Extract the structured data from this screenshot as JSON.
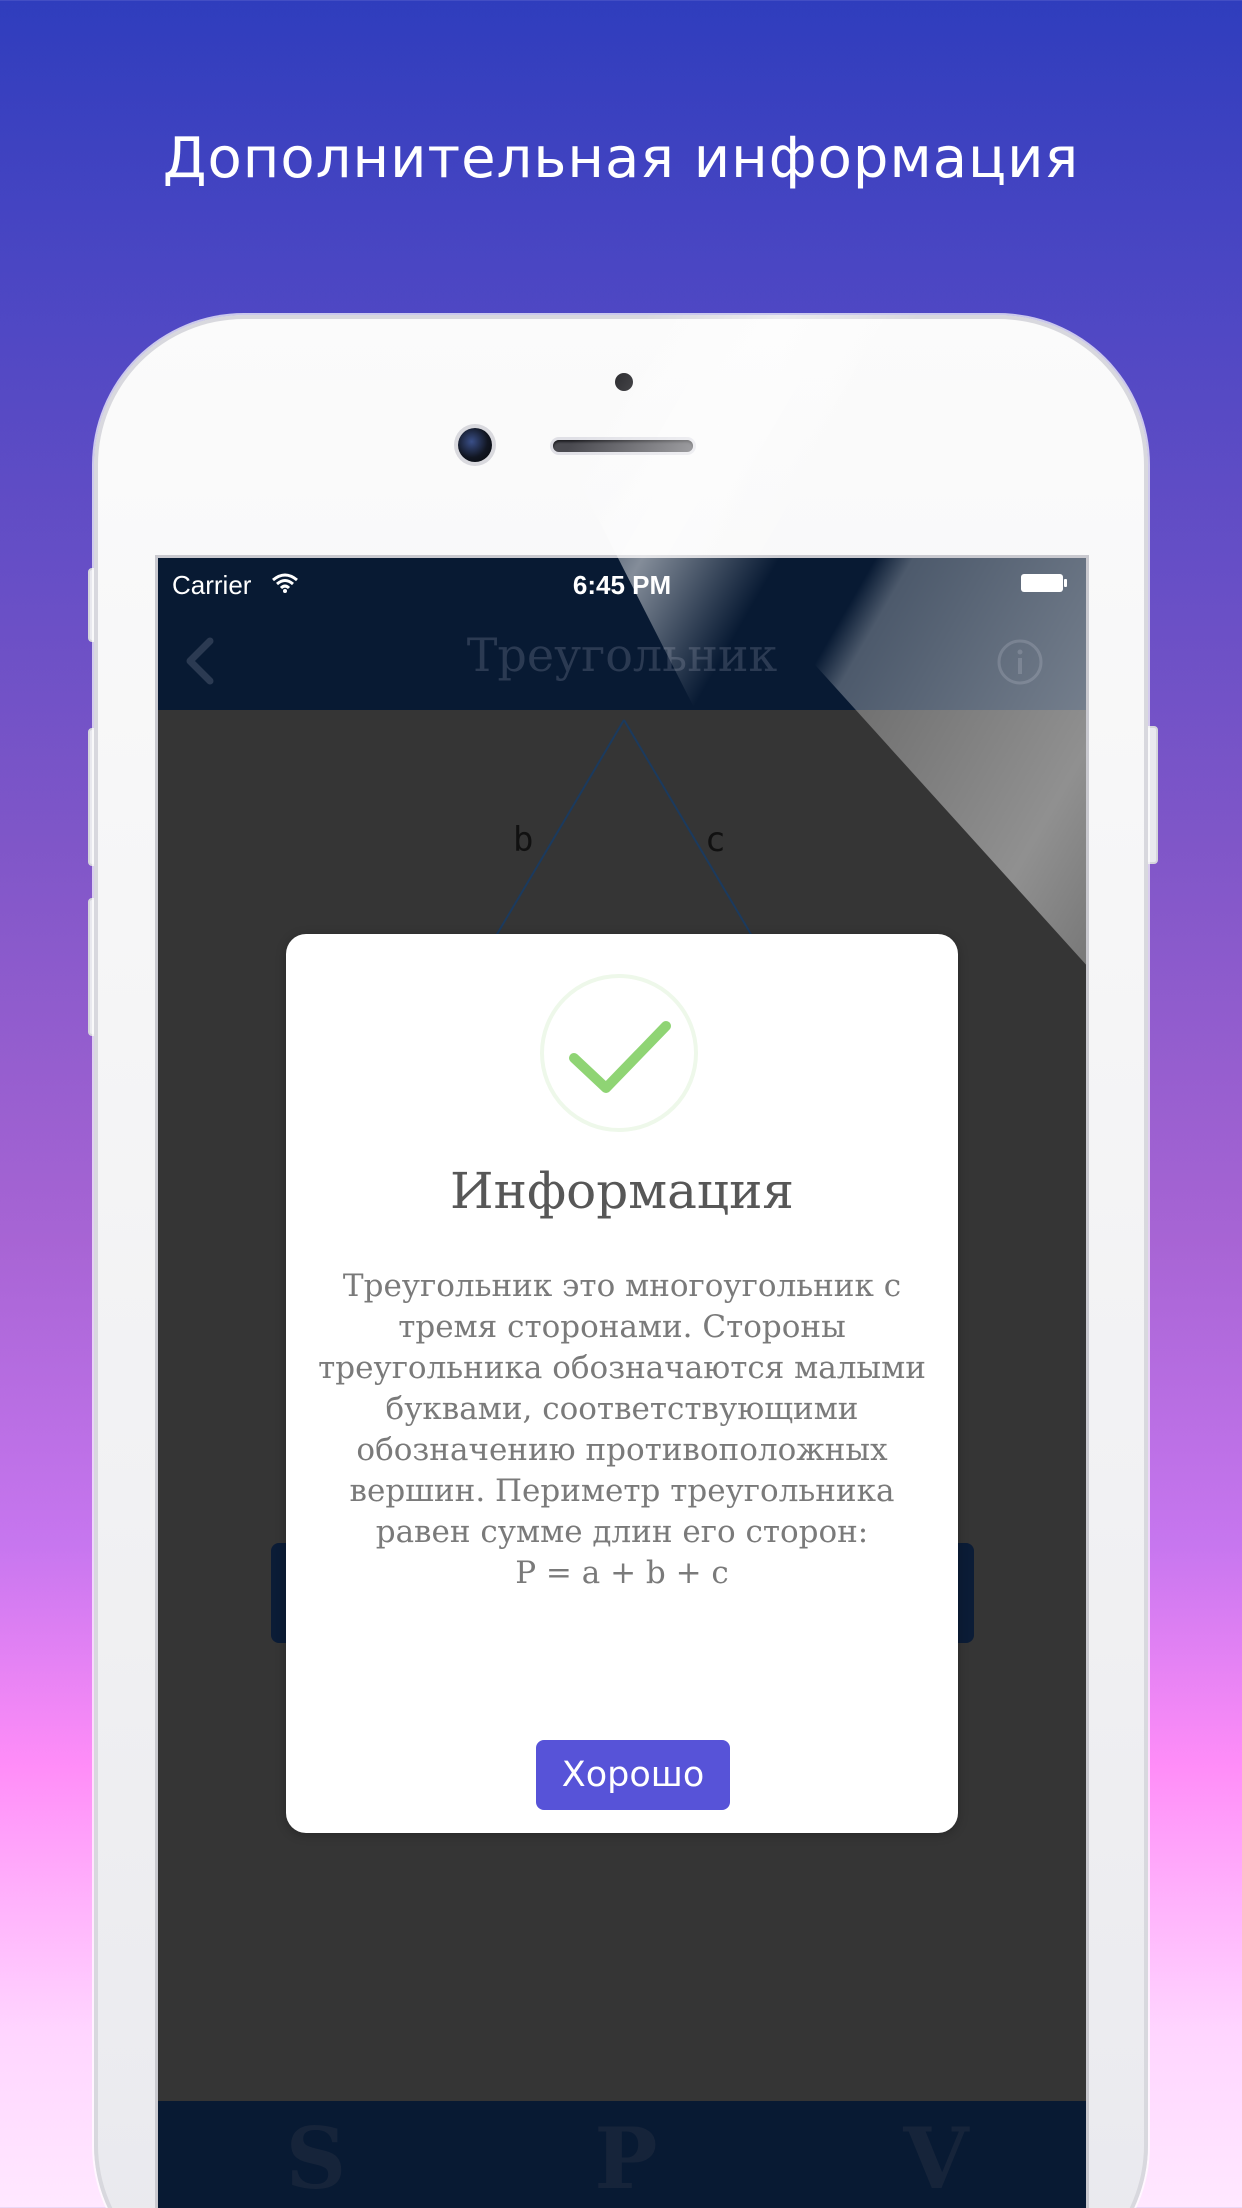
{
  "headline": "Дополнительная информация",
  "status_bar": {
    "carrier": "Carrier",
    "time": "6:45 PM"
  },
  "nav": {
    "title": "Треугольник",
    "back_icon": "chevron-left-icon",
    "info_icon": "info-icon"
  },
  "triangle": {
    "labels": [
      "b",
      "c"
    ]
  },
  "tabs": [
    "S",
    "P",
    "V"
  ],
  "dialog": {
    "icon": "checkmark-icon",
    "title": "Информация",
    "text": "Треугольник это многоугольник с тремя сторонами. Стороны треугольника обозначаются малыми буквами, соответствующими обозначению противоположных вершин. Периметр треугольника равен сумме длин его сторон:",
    "formula": "P = a + b + c",
    "ok_label": "Хорошо"
  },
  "colors": {
    "accent": "#5753d8",
    "check": "#8fd474",
    "nav_bg": "#081a33",
    "overlay": "#353535"
  }
}
